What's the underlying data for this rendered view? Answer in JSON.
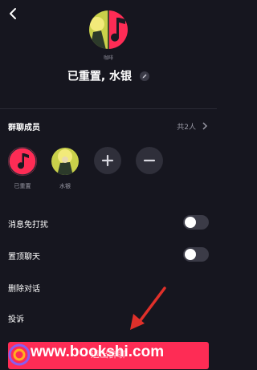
{
  "header": {
    "back_icon": "chevron-left-icon",
    "avatar_caption": "咖啡",
    "group_name": "已重置, 水银",
    "edit_icon": "pencil-icon"
  },
  "members_section": {
    "title": "群聊成员",
    "count": "共2人",
    "chevron_icon": "chevron-right-icon",
    "members": [
      {
        "name": "已重置",
        "avatar": "app-logo-avatar"
      },
      {
        "name": "水银",
        "avatar": "anime-character-avatar"
      }
    ],
    "add_icon": "plus-icon",
    "remove_icon": "minus-icon"
  },
  "settings": {
    "mute": {
      "label": "消息免打扰",
      "on": false
    },
    "pin": {
      "label": "置顶聊天",
      "on": false
    },
    "delete_chat": "删除对话",
    "report": "投诉"
  },
  "exit_button": {
    "label": "退出群聊"
  },
  "watermark": {
    "text": "www.bookshi.com"
  },
  "colors": {
    "background": "#16161f",
    "accent": "#fe2c55",
    "muted_text": "#9a9aa6",
    "annotation_arrow": "#e0302a"
  }
}
